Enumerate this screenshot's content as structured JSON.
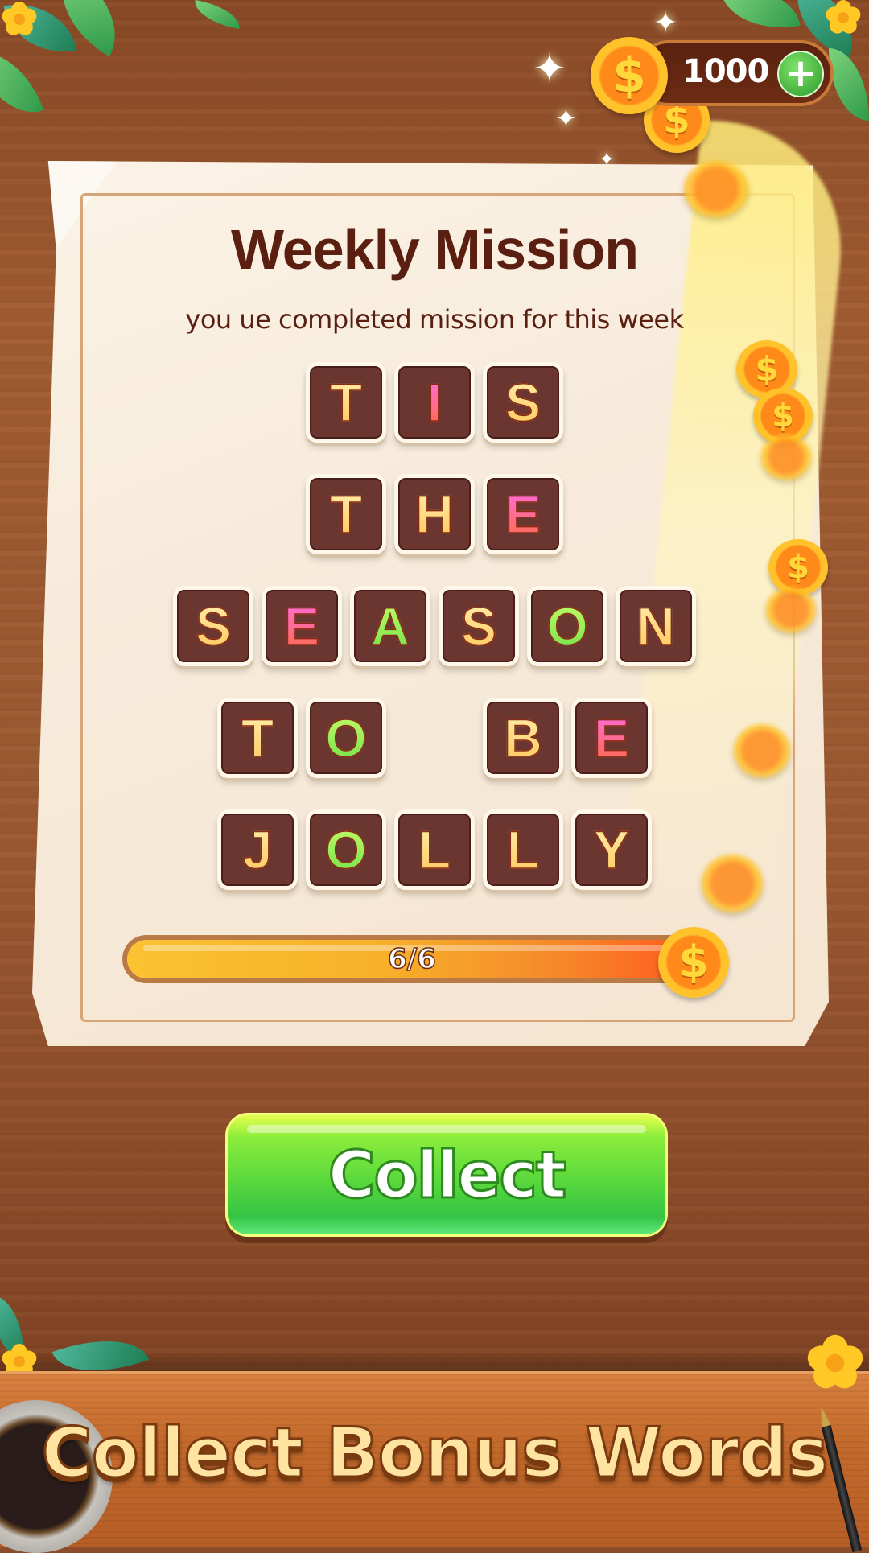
{
  "header": {
    "coin_balance": "1000",
    "add_coins_symbol": "+",
    "coin_symbol": "$"
  },
  "mission": {
    "title": "Weekly Mission",
    "subtitle": "you ue completed mission for this week",
    "phrase_rows": [
      [
        {
          "ch": "T",
          "color": "gold"
        },
        {
          "ch": "I",
          "color": "pink"
        },
        {
          "ch": "S",
          "color": "gold"
        }
      ],
      [
        {
          "ch": "T",
          "color": "gold"
        },
        {
          "ch": "H",
          "color": "gold"
        },
        {
          "ch": "E",
          "color": "pink"
        }
      ],
      [
        {
          "ch": "S",
          "color": "gold"
        },
        {
          "ch": "E",
          "color": "pink"
        },
        {
          "ch": "A",
          "color": "green"
        },
        {
          "ch": "S",
          "color": "gold"
        },
        {
          "ch": "O",
          "color": "green"
        },
        {
          "ch": "N",
          "color": "gold"
        }
      ],
      [
        {
          "ch": "T",
          "color": "gold"
        },
        {
          "ch": "O",
          "color": "green"
        },
        {
          "ch": "",
          "color": "gap"
        },
        {
          "ch": "B",
          "color": "gold"
        },
        {
          "ch": "E",
          "color": "pink"
        }
      ],
      [
        {
          "ch": "J",
          "color": "gold"
        },
        {
          "ch": "O",
          "color": "green"
        },
        {
          "ch": "L",
          "color": "gold"
        },
        {
          "ch": "L",
          "color": "gold"
        },
        {
          "ch": "Y",
          "color": "gold"
        }
      ]
    ],
    "progress": {
      "current": 6,
      "total": 6,
      "label": "6/6",
      "fraction": 1.0
    }
  },
  "collect_button": {
    "label": "Collect"
  },
  "banner": {
    "text": "Collect Bonus Words"
  },
  "colors": {
    "gold": [
      "#fff1b0",
      "#ffc65a"
    ],
    "pink": [
      "#ff6ef0",
      "#ff6a3c"
    ],
    "green": [
      "#c8ff6a",
      "#6ee04a"
    ],
    "tile_bg": "#6b3630",
    "title_text": "#5a1f10",
    "button_green": "#5ad83c"
  }
}
